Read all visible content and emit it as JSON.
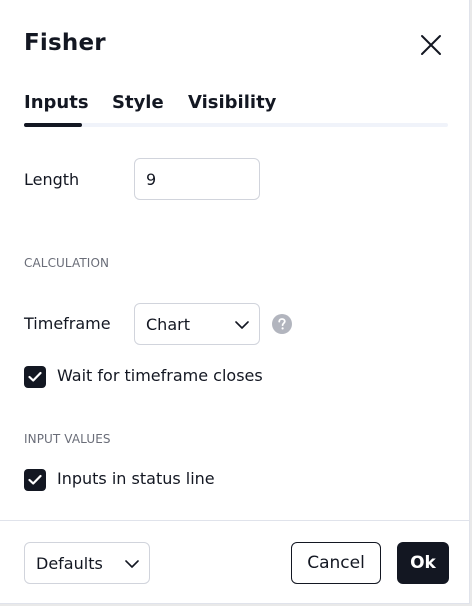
{
  "dialog": {
    "title": "Fisher",
    "close_icon": "close-icon"
  },
  "tabs": [
    {
      "label": "Inputs",
      "active": true
    },
    {
      "label": "Style",
      "active": false
    },
    {
      "label": "Visibility",
      "active": false
    }
  ],
  "inputs": {
    "length_label": "Length",
    "length_value": "9",
    "calculation_section": "CALCULATION",
    "timeframe_label": "Timeframe",
    "timeframe_value": "Chart",
    "help_icon": "question-circle-icon",
    "wait_checkbox": {
      "label": "Wait for timeframe closes",
      "checked": true
    },
    "input_values_section": "INPUT VALUES",
    "status_line_checkbox": {
      "label": "Inputs in status line",
      "checked": true
    }
  },
  "footer": {
    "defaults_label": "Defaults",
    "cancel_label": "Cancel",
    "ok_label": "Ok"
  },
  "colors": {
    "primary": "#131722",
    "border": "#d1d4dc",
    "muted_text": "#6a6d78",
    "tab_track": "#f0f3fa"
  }
}
